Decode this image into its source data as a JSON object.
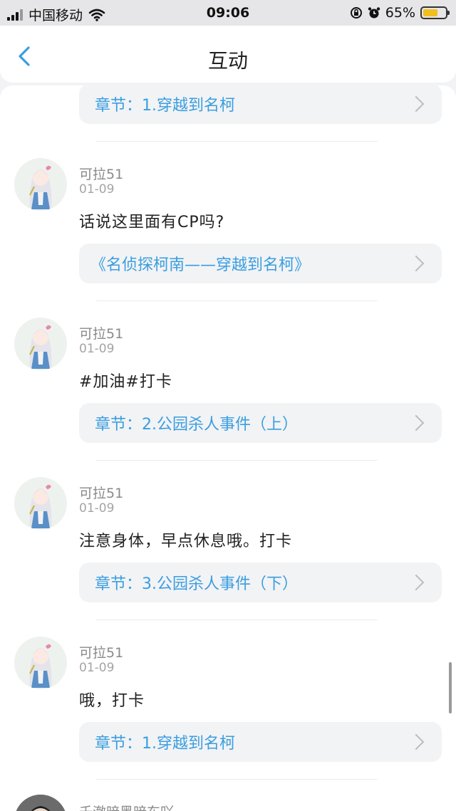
{
  "status_bar": {
    "carrier": "中国移动",
    "time": "09:06",
    "battery": "65%",
    "battery_level": 0.65,
    "icons": [
      "signal-icon",
      "wifi-icon",
      "rotation-lock-icon",
      "alarm-icon",
      "battery-icon"
    ]
  },
  "header": {
    "title": "互动",
    "back_icon": "back-chevron-icon"
  },
  "top_card": {
    "label": "章节：1.穿越到名柯"
  },
  "posts": [
    {
      "user": "可拉51",
      "date": "01-09",
      "text": "话说这里面有CP吗?",
      "card": "《名侦探柯南——穿越到名柯》"
    },
    {
      "user": "可拉51",
      "date": "01-09",
      "text": "#加油#打卡",
      "card": "章节：2.公园杀人事件（上）"
    },
    {
      "user": "可拉51",
      "date": "01-09",
      "text": "注意身体，早点休息哦。打卡",
      "card": "章节：3.公园杀人事件（下）"
    },
    {
      "user": "可拉51",
      "date": "01-09",
      "text": "哦，打卡",
      "card": "章节：1.穿越到名柯"
    }
  ],
  "partial_user": "千澈暗黑暗东吖",
  "colors": {
    "accent": "#3a9ee0",
    "battery": "#f2c01e",
    "card_bg": "#f2f3f5"
  }
}
